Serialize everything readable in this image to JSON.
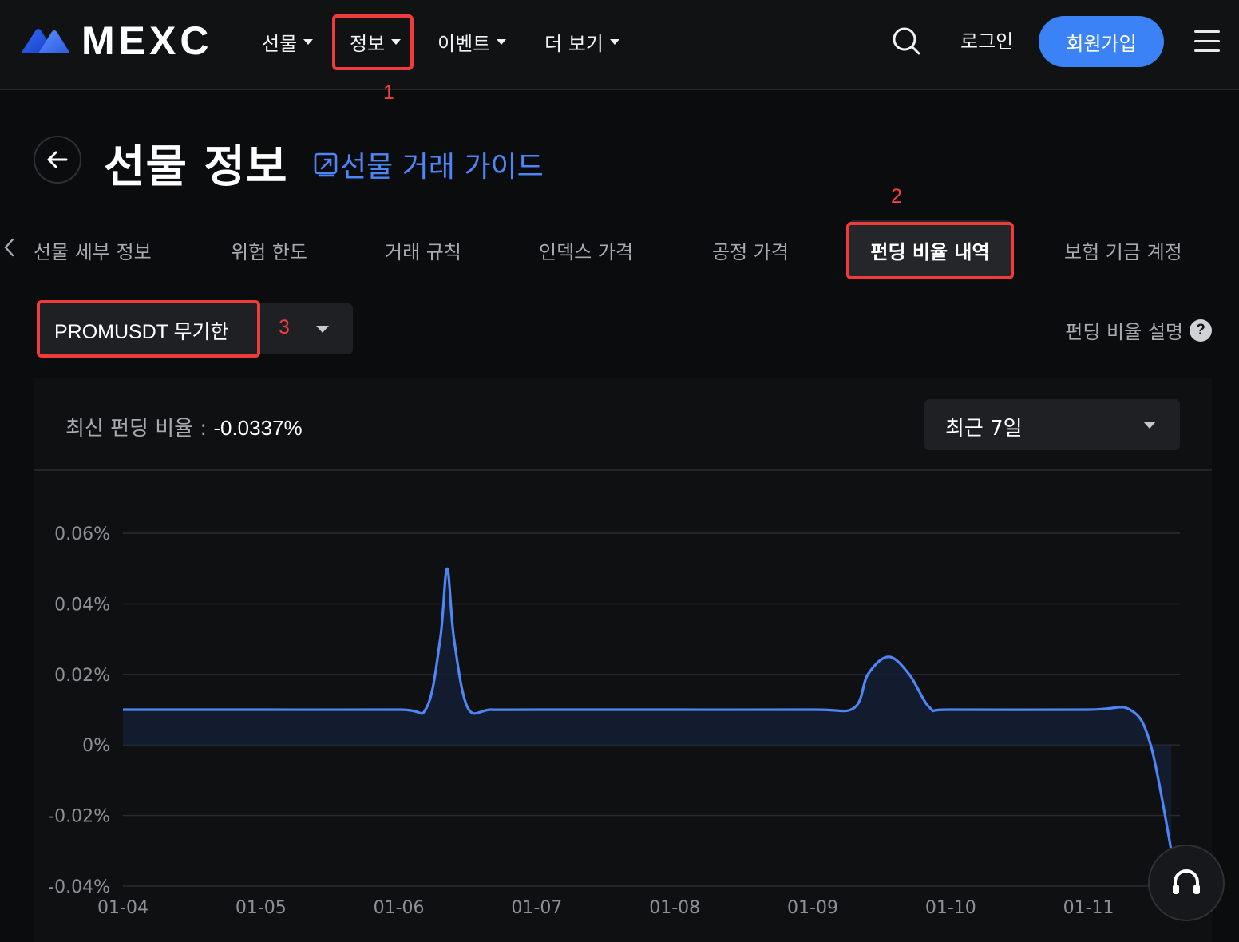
{
  "header": {
    "brand": "MEXC",
    "nav": [
      {
        "label": "선물"
      },
      {
        "label": "정보"
      },
      {
        "label": "이벤트"
      },
      {
        "label": "더 보기"
      }
    ],
    "login_label": "로그인",
    "signup_label": "회원가입",
    "accent_color": "#3b82f6"
  },
  "annotations": {
    "m1": "1",
    "m2": "2",
    "m3": "3",
    "color": "#ef3b3b"
  },
  "page": {
    "title": "선물 정보",
    "guide_link": "선물 거래 가이드",
    "tabs": [
      {
        "label": "선물 세부 정보"
      },
      {
        "label": "위험 한도"
      },
      {
        "label": "거래 규칙"
      },
      {
        "label": "인덱스 가격"
      },
      {
        "label": "공정 가격"
      },
      {
        "label": "펀딩 비율 내역"
      },
      {
        "label": "보험 기금 계정"
      }
    ],
    "active_tab_index": 5
  },
  "selector": {
    "label": "PROMUSDT 무기한"
  },
  "funding_explain": {
    "label": "펀딩 비율 설명",
    "icon": "question-icon"
  },
  "summary": {
    "latest_label": "최신 펀딩 비율 : ",
    "latest_value": "-0.0337%"
  },
  "range_select": {
    "label": "최근 7일"
  },
  "chart_data": {
    "type": "area",
    "y_tick_labels": [
      "0.06%",
      "0.04%",
      "0.02%",
      "0%",
      "-0.02%",
      "-0.04%"
    ],
    "ylim": [
      -0.04,
      0.06
    ],
    "x_tick_labels": [
      "01-04",
      "01-05",
      "01-06",
      "01-07",
      "01-08",
      "01-09",
      "01-10",
      "01-11"
    ],
    "grid": true,
    "line_color": "#4f86f7",
    "series": [
      {
        "points": [
          [
            0,
            0.01
          ],
          [
            1.0,
            0.01
          ],
          [
            2.0,
            0.01
          ],
          [
            2.2,
            0.0105
          ],
          [
            2.3,
            0.03
          ],
          [
            2.35,
            0.05
          ],
          [
            2.4,
            0.03
          ],
          [
            2.5,
            0.0105
          ],
          [
            2.67,
            0.01
          ],
          [
            3.0,
            0.01
          ],
          [
            4.0,
            0.01
          ],
          [
            5.0,
            0.01
          ],
          [
            5.3,
            0.0105
          ],
          [
            5.4,
            0.02
          ],
          [
            5.55,
            0.025
          ],
          [
            5.7,
            0.02
          ],
          [
            5.85,
            0.0105
          ],
          [
            6.0,
            0.01
          ],
          [
            7.0,
            0.01
          ],
          [
            7.3,
            0.01
          ],
          [
            7.45,
            0.0
          ],
          [
            7.6,
            -0.03
          ]
        ]
      }
    ]
  }
}
